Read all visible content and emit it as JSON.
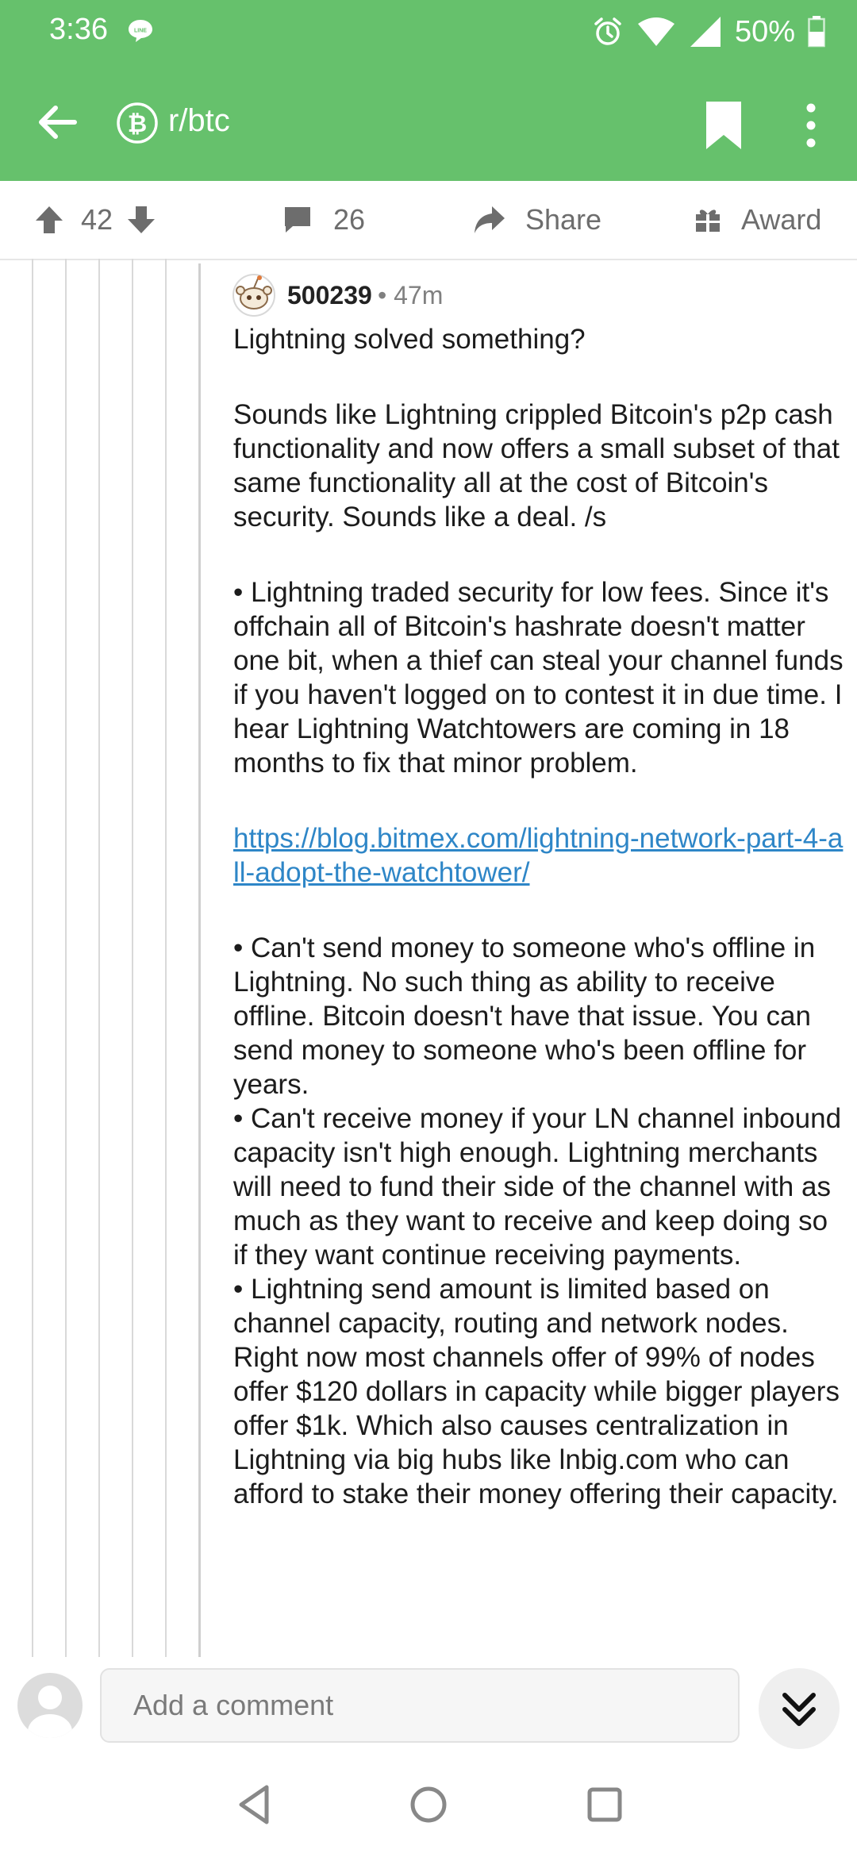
{
  "status_bar": {
    "time": "3:36",
    "battery": "50%",
    "line_badge": "LINE"
  },
  "app_bar": {
    "subreddit": "r/btc",
    "icons": [
      "back-arrow-icon",
      "bitcoin-cash-icon",
      "bookmark-icon",
      "more-vertical-icon"
    ]
  },
  "actions": {
    "score": "42",
    "comments": "26",
    "share_label": "Share",
    "award_label": "Award"
  },
  "comment": {
    "author": "500239",
    "age": "• 47m",
    "paragraphs": {
      "p1": "Lightning solved something?",
      "p2": "Sounds like Lightning crippled Bitcoin's p2p cash functionality and now offers a small subset of that same functionality all at the cost of Bitcoin's security. Sounds like a deal. /s",
      "p3": "• Lightning traded security for low fees. Since it's offchain all of Bitcoin's hashrate doesn't matter one bit, when a thief can steal your channel funds if you haven't logged on to contest it in due time. I hear Lightning Watchtowers are coming in 18 months to fix that minor problem.",
      "link": "https://blog.bitmex.com/lightning-network-part-4-all-adopt-the-watchtower/",
      "p4": "• Can't send money to someone who's offline in Lightning. No such thing as ability to receive offline. Bitcoin doesn't have that issue. You can send money to someone who's been offline for years.",
      "p5": "• Can't receive money if your LN channel inbound capacity isn't high enough. Lightning merchants will need to fund their side of the channel with as much as they want to receive and keep doing so if they want continue receiving payments.",
      "p6": "• Lightning send amount is limited based on channel capacity, routing and network nodes. Right now most channels offer of 99% of nodes offer $120 dollars in capacity while bigger players offer $1k. Which also causes centralization in Lightning via big hubs like lnbig.com who can afford to stake their money offering their capacity."
    }
  },
  "compose": {
    "placeholder": "Add a comment"
  },
  "colors": {
    "header": "#66c16c",
    "link": "#2e86c7",
    "text": "#1c1c1c",
    "muted": "#6d6d6d"
  }
}
